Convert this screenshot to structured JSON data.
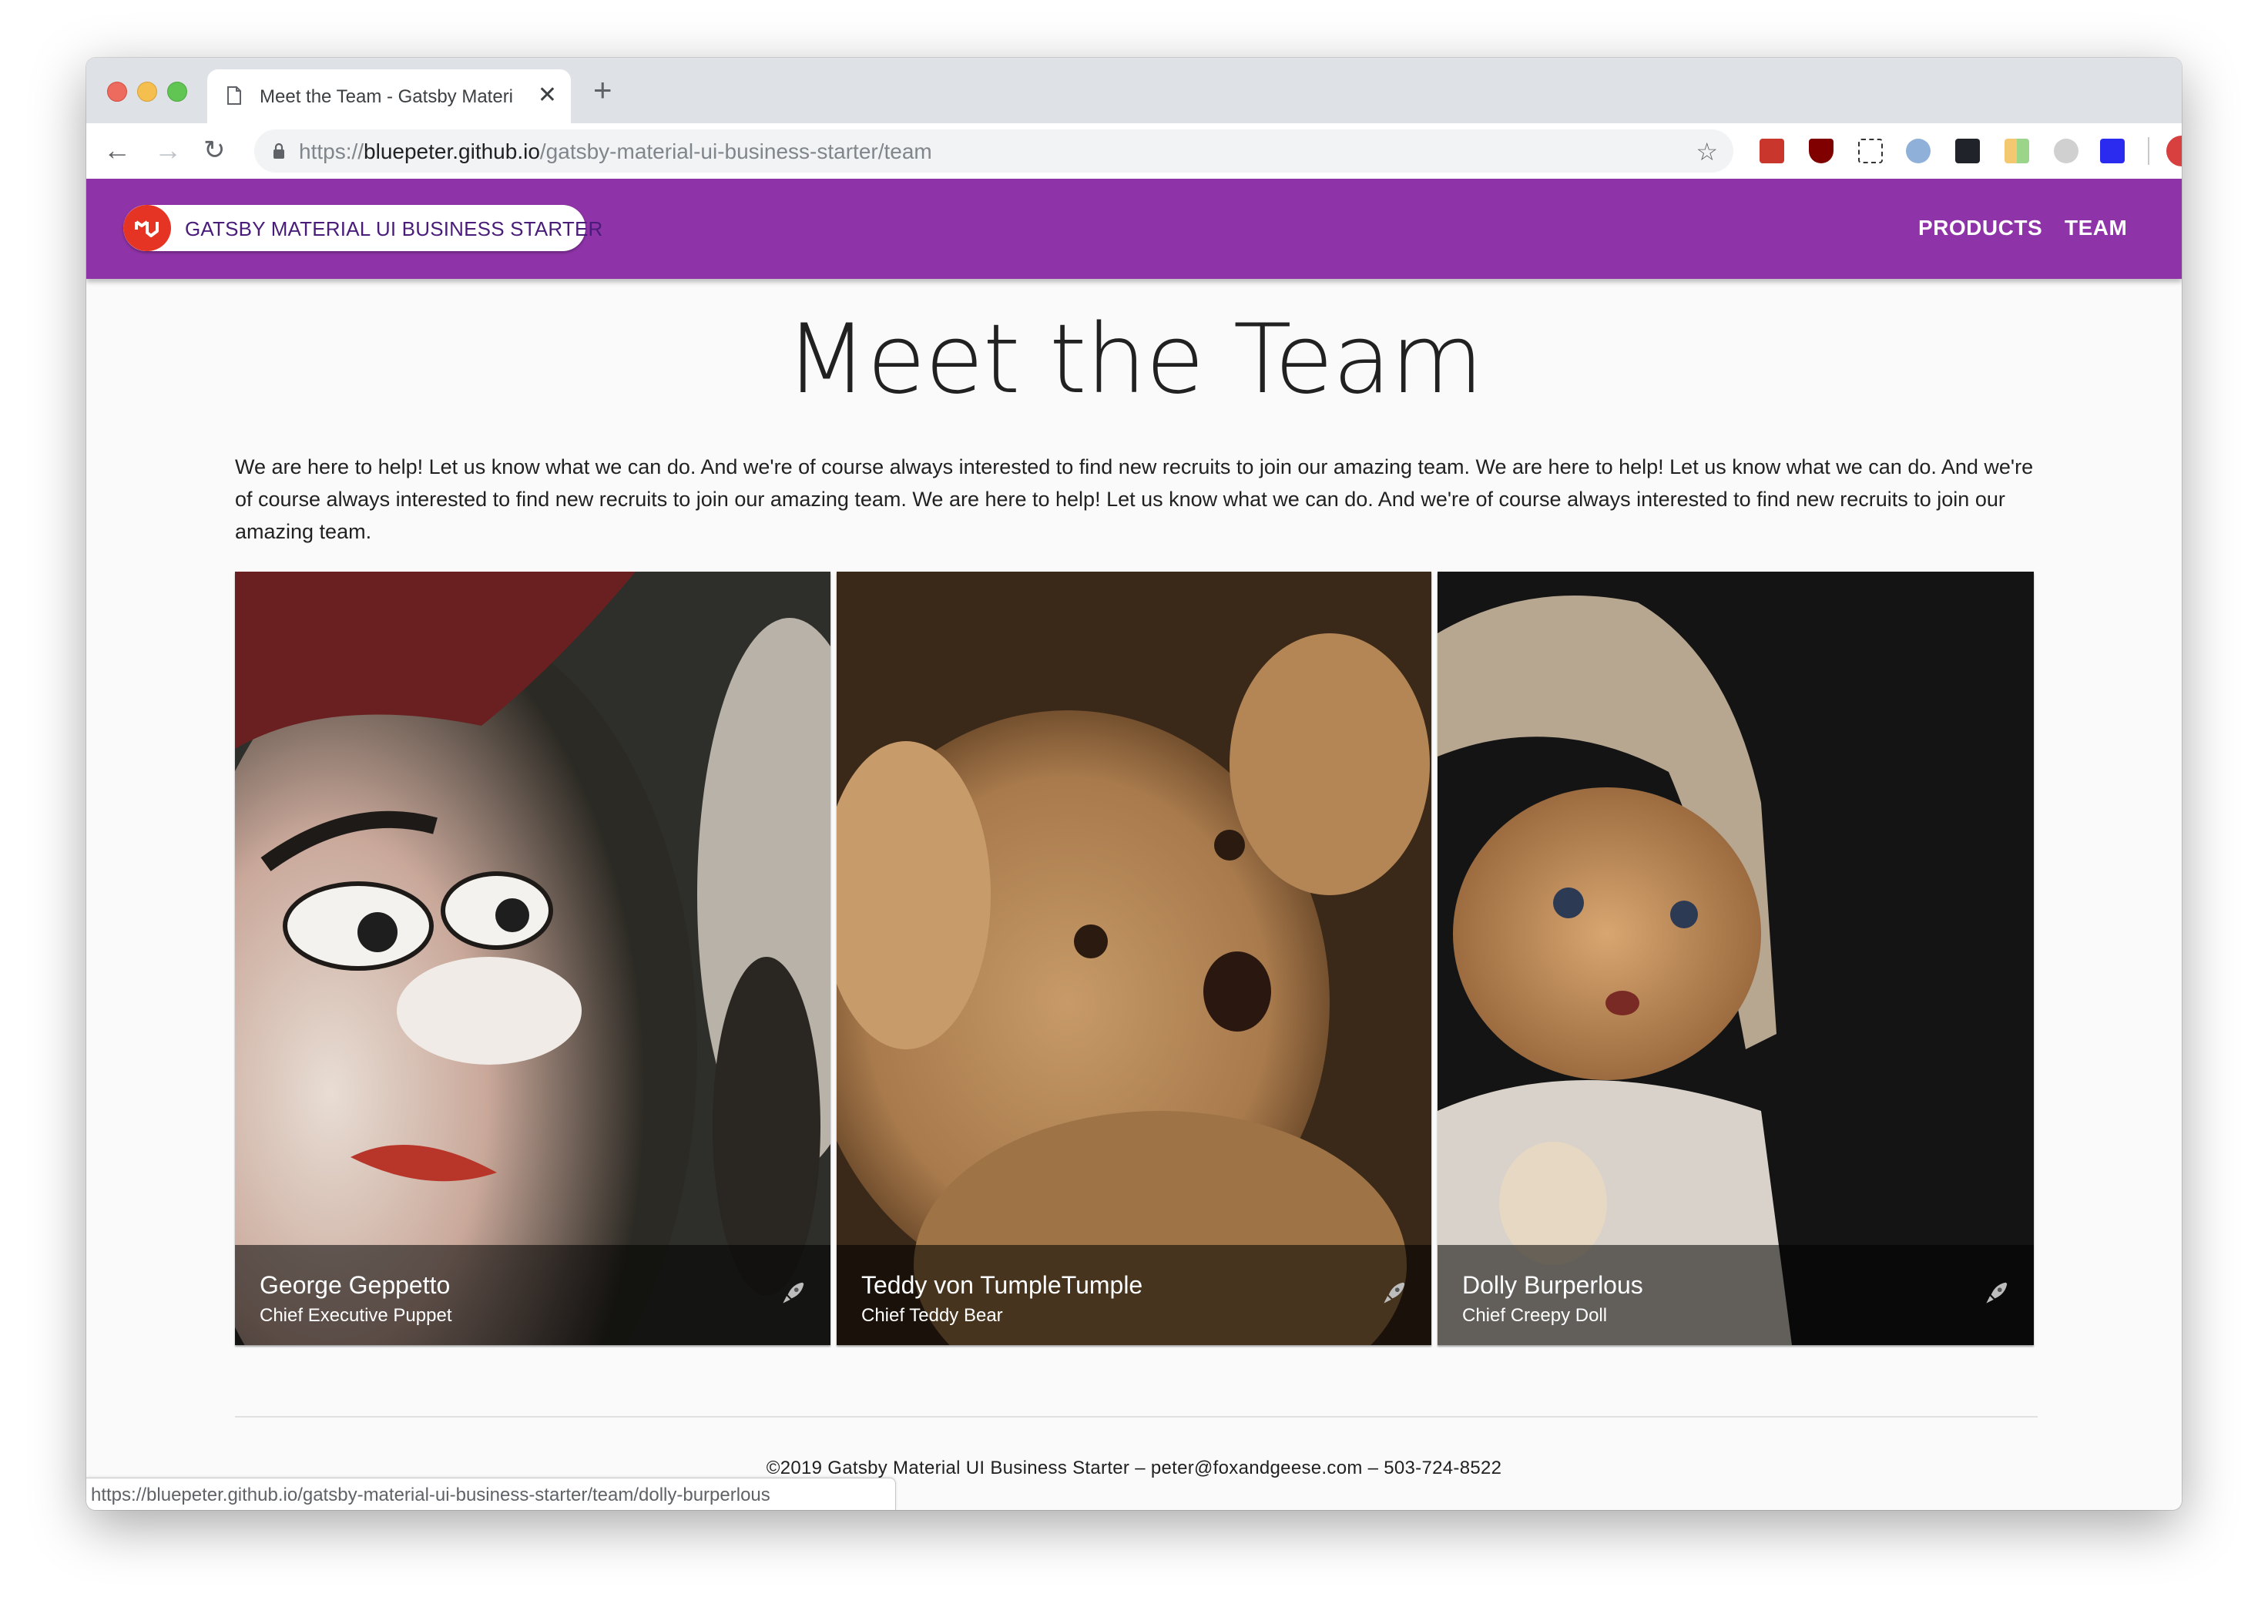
{
  "browser": {
    "tab": {
      "title": "Meet the Team - Gatsby Materi",
      "close_glyph": "✕",
      "icon": "document-icon"
    },
    "new_tab_glyph": "+",
    "nav": {
      "back": "←",
      "forward": "→",
      "reload": "↻"
    },
    "address": {
      "scheme": "https://",
      "host": "bluepeter.github.io",
      "path": "/gatsby-material-ui-business-starter/team"
    },
    "bookmark_glyph": "☆",
    "extensions": [
      {
        "name": "lastpass-extension-icon",
        "color": "#c9372c"
      },
      {
        "name": "ublock-extension-icon",
        "color": "#800000"
      },
      {
        "name": "notion-clipper-extension-icon",
        "color": "#1a3a8a"
      },
      {
        "name": "json-viewer-extension-icon",
        "color": "#8fb0d8"
      },
      {
        "name": "react-devtools-extension-icon",
        "color": "#20232a"
      },
      {
        "name": "tab-manager-extension-icon",
        "color": "#f4c870"
      },
      {
        "name": "grey-ring-extension-icon",
        "color": "#b0b0b0"
      },
      {
        "name": "blue-s-extension-icon",
        "color": "#2b2bf0"
      }
    ],
    "profile_color": "#d84040",
    "menu_glyph": "⋮"
  },
  "appbar": {
    "background": "#8e33a8",
    "brand_logo_text": "MUI",
    "brand_label": "GATSBY MATERIAL UI BUSINESS STARTER",
    "links": [
      {
        "label": "PRODUCTS"
      },
      {
        "label": "TEAM"
      }
    ]
  },
  "page": {
    "title": "Meet the Team",
    "intro": "We are here to help! Let us know what we can do. And we're of course always interested to find new recruits to join our amazing team. We are here to help! Let us know what we can do. And we're of course always interested to find new recruits to join our amazing team. We are here to help! Let us know what we can do. And we're of course always interested to find new recruits to join our amazing team."
  },
  "team": [
    {
      "name": "George Geppetto",
      "role": "Chief Executive Puppet",
      "image": "ventriloquist-puppet-photo",
      "icon": "rocket-icon"
    },
    {
      "name": "Teddy von TumpleTumple",
      "role": "Chief Teddy Bear",
      "image": "teddy-bear-photo",
      "icon": "rocket-icon"
    },
    {
      "name": "Dolly Burperlous",
      "role": "Chief Creepy Doll",
      "image": "antique-doll-photo",
      "icon": "rocket-icon"
    }
  ],
  "footer": {
    "text": "©2019 Gatsby Material UI Business Starter – peter@foxandgeese.com – 503-724-8522"
  },
  "status_bar": {
    "url": "https://bluepeter.github.io/gatsby-material-ui-business-starter/team/dolly-burperlous"
  }
}
